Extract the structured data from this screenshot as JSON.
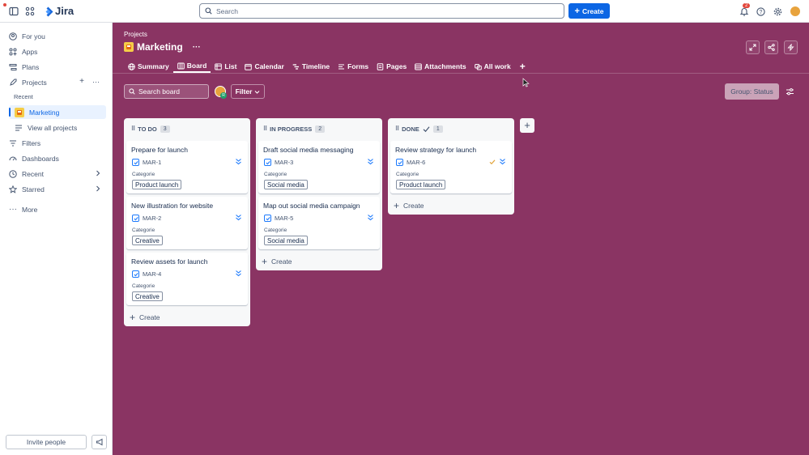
{
  "app": {
    "name": "Jira"
  },
  "topbar": {
    "search_placeholder": "Search",
    "create_label": "Create",
    "notification_count": "2"
  },
  "sidebar": {
    "for_you": "For you",
    "apps": "Apps",
    "plans": "Plans",
    "projects": "Projects",
    "recent_header": "Recent",
    "marketing": "Marketing",
    "view_all_projects": "View all projects",
    "filters": "Filters",
    "dashboards": "Dashboards",
    "recent": "Recent",
    "starred": "Starred",
    "more": "More",
    "invite_label": "Invite people"
  },
  "header": {
    "breadcrumb": "Projects",
    "title": "Marketing",
    "more": "···"
  },
  "tabs": {
    "summary": "Summary",
    "board": "Board",
    "list": "List",
    "calendar": "Calendar",
    "timeline": "Timeline",
    "forms": "Forms",
    "pages": "Pages",
    "attachments": "Attachments",
    "all_work": "All work",
    "add": "+"
  },
  "toolbar": {
    "search_placeholder": "Search board",
    "avatar_initial": "R",
    "filter_label": "Filter",
    "group_label": "Group: Status"
  },
  "columns": {
    "todo": {
      "title": "TO DO",
      "count": "3",
      "create_label": "Create",
      "cards": [
        {
          "title": "Prepare for launch",
          "key": "MAR-1",
          "category_label": "Categorie",
          "category": "Product launch"
        },
        {
          "title": "New illustration for website",
          "key": "MAR-2",
          "category_label": "Categorie",
          "category": "Creative"
        },
        {
          "title": "Review assets for launch",
          "key": "MAR-4",
          "category_label": "Categorie",
          "category": "Creative"
        }
      ]
    },
    "inprogress": {
      "title": "IN PROGRESS",
      "count": "2",
      "create_label": "Create",
      "cards": [
        {
          "title": "Draft social media messaging",
          "key": "MAR-3",
          "category_label": "Categorie",
          "category": "Social media"
        },
        {
          "title": "Map out social media campaign",
          "key": "MAR-5",
          "category_label": "Categorie",
          "category": "Social media"
        }
      ]
    },
    "done": {
      "title": "DONE",
      "count": "1",
      "create_label": "Create",
      "cards": [
        {
          "title": "Review strategy for launch",
          "key": "MAR-6",
          "category_label": "Categorie",
          "category": "Product launch"
        }
      ]
    }
  },
  "colors": {
    "board_background": "#8a3463",
    "accent": "#0c66e4",
    "priority": "#1d7afc",
    "done_check": "#e2a53d"
  },
  "icons": {
    "priority": "double-chevron-down-icon",
    "work_type": "task-checkbox-icon"
  }
}
